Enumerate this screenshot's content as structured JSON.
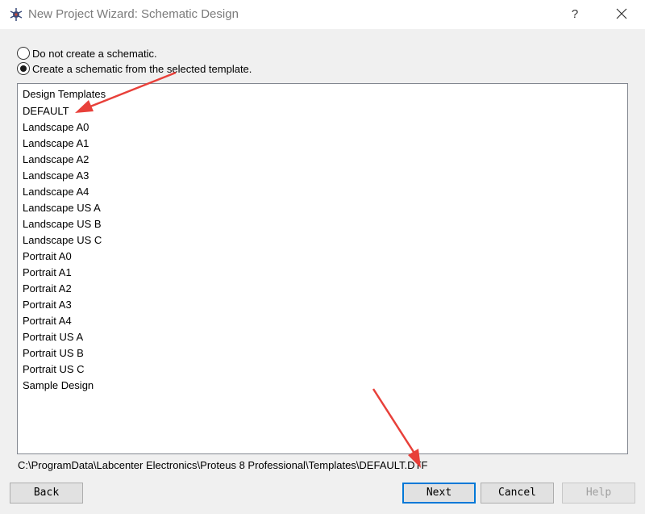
{
  "window": {
    "title": "New Project Wizard: Schematic Design",
    "help_glyph": "?"
  },
  "options": {
    "no_schematic": "Do not create a schematic.",
    "from_template": "Create a schematic from the selected template."
  },
  "templates": [
    "Design Templates",
    "DEFAULT",
    "Landscape A0",
    "Landscape A1",
    "Landscape A2",
    "Landscape A3",
    "Landscape A4",
    "Landscape US A",
    "Landscape US B",
    "Landscape US C",
    "Portrait A0",
    "Portrait A1",
    "Portrait A2",
    "Portrait A3",
    "Portrait A4",
    "Portrait US A",
    "Portrait US B",
    "Portrait US C",
    "Sample Design"
  ],
  "selected_path": "C:\\ProgramData\\Labcenter Electronics\\Proteus 8 Professional\\Templates\\DEFAULT.DTF",
  "buttons": {
    "back": "Back",
    "next": "Next",
    "cancel": "Cancel",
    "help": "Help"
  },
  "colors": {
    "annotation_arrow": "#e8403a",
    "default_button_border": "#0078d7"
  }
}
